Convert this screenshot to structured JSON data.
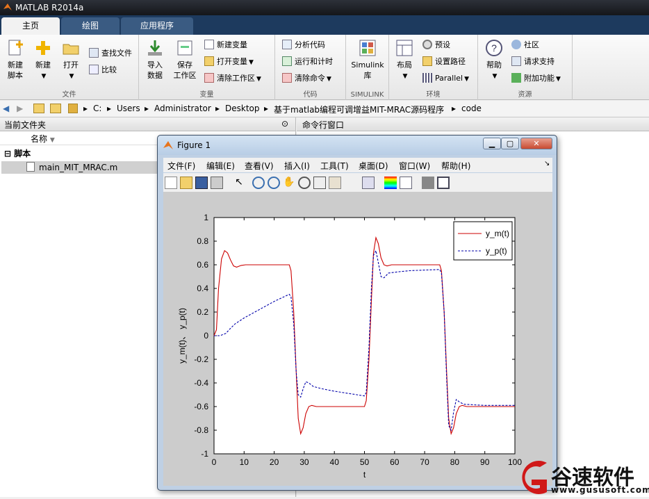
{
  "app": {
    "title": "MATLAB R2014a"
  },
  "tabs": [
    "主页",
    "绘图",
    "应用程序"
  ],
  "ribbon": {
    "file": {
      "new_script": [
        "新建",
        "脚本"
      ],
      "new": "新建",
      "open": "打开",
      "find_files": "查找文件",
      "compare": "比较",
      "label": "文件"
    },
    "variable": {
      "import": [
        "导入",
        "数据"
      ],
      "save": [
        "保存",
        "工作区"
      ],
      "new_var": "新建变量",
      "open_var": "打开变量",
      "clear_ws": "清除工作区",
      "label": "变量"
    },
    "code": {
      "analyze": "分析代码",
      "run_time": "运行和计时",
      "clear_cmd": "清除命令",
      "label": "代码"
    },
    "simulink": {
      "lib": [
        "Simulink",
        "库"
      ],
      "label": "SIMULINK"
    },
    "env": {
      "layout": "布局",
      "prefs": "预设",
      "set_path": "设置路径",
      "parallel": "Parallel",
      "label": "环境"
    },
    "resources": {
      "help": "帮助",
      "community": "社区",
      "support": "请求支持",
      "addons": "附加功能",
      "label": "资源"
    }
  },
  "address": [
    "C:",
    "Users",
    "Administrator",
    "Desktop",
    "基于matlab编程可调增益MIT-MRAC源码程序",
    "code"
  ],
  "current_folder": {
    "title": "当前文件夹",
    "col_name": "名称",
    "group": "脚本",
    "file": "main_MIT_MRAC.m"
  },
  "command_window": {
    "title": "命令行窗口"
  },
  "figure": {
    "title": "Figure 1",
    "menu": [
      "文件(F)",
      "编辑(E)",
      "查看(V)",
      "插入(I)",
      "工具(T)",
      "桌面(D)",
      "窗口(W)",
      "帮助(H)"
    ]
  },
  "watermark": {
    "name": "谷速软件",
    "url": "www.gususoft.com"
  },
  "chart_data": {
    "type": "line",
    "xlabel": "t",
    "ylabel": "y_m(t)、 y_p(t)",
    "xlim": [
      0,
      100
    ],
    "ylim": [
      -1,
      1
    ],
    "xticks": [
      0,
      10,
      20,
      30,
      40,
      50,
      60,
      70,
      80,
      90,
      100
    ],
    "yticks": [
      -1,
      -0.8,
      -0.6,
      -0.4,
      -0.2,
      0,
      0.2,
      0.4,
      0.6,
      0.8,
      1
    ],
    "legend_position": "top-right",
    "series": [
      {
        "name": "y_m(t)",
        "color": "#cc0000",
        "style": "solid",
        "x": [
          0,
          0.8,
          1.5,
          2.5,
          3.5,
          4.5,
          5.5,
          6.5,
          7.5,
          9,
          10.5,
          12,
          15,
          20,
          25,
          25.6,
          26.5,
          27.3,
          28,
          28.8,
          29.6,
          30.5,
          31.5,
          32.5,
          34,
          36,
          40,
          45,
          50,
          50.6,
          51.5,
          52.3,
          53,
          53.8,
          54.6,
          55.5,
          56.5,
          57.5,
          59,
          61,
          65,
          70,
          75,
          75.6,
          76.5,
          77.3,
          78,
          78.8,
          79.6,
          80.5,
          81.5,
          82.5,
          84,
          86,
          90,
          95,
          100
        ],
        "y": [
          0,
          0.05,
          0.4,
          0.65,
          0.72,
          0.7,
          0.64,
          0.59,
          0.58,
          0.595,
          0.6,
          0.6,
          0.6,
          0.6,
          0.6,
          0.55,
          0.2,
          -0.3,
          -0.7,
          -0.83,
          -0.78,
          -0.66,
          -0.6,
          -0.59,
          -0.6,
          -0.6,
          -0.6,
          -0.6,
          -0.6,
          -0.55,
          -0.2,
          0.3,
          0.7,
          0.83,
          0.78,
          0.66,
          0.6,
          0.59,
          0.6,
          0.6,
          0.6,
          0.6,
          0.6,
          0.55,
          0.2,
          -0.3,
          -0.7,
          -0.83,
          -0.78,
          -0.66,
          -0.6,
          -0.59,
          -0.6,
          -0.6,
          -0.6,
          -0.6,
          -0.6
        ]
      },
      {
        "name": "y_p(t)",
        "color": "#0000aa",
        "style": "dashed",
        "x": [
          0,
          2,
          3,
          4,
          5,
          7,
          10,
          15,
          20,
          25,
          25.6,
          26.5,
          27.3,
          28,
          28.8,
          29.6,
          30.5,
          31.5,
          33,
          36,
          40,
          45,
          50,
          50.6,
          51.5,
          52.3,
          53,
          53.8,
          54.6,
          55.5,
          56.5,
          58,
          61,
          65,
          70,
          75,
          75.6,
          76.5,
          77.3,
          78,
          78.8,
          79.6,
          80.5,
          81.5,
          83,
          86,
          90,
          95,
          100
        ],
        "y": [
          0,
          0,
          0.01,
          0.02,
          0.05,
          0.1,
          0.15,
          0.22,
          0.29,
          0.35,
          0.33,
          0.1,
          -0.3,
          -0.5,
          -0.52,
          -0.45,
          -0.39,
          -0.4,
          -0.43,
          -0.45,
          -0.47,
          -0.49,
          -0.51,
          -0.48,
          -0.1,
          0.4,
          0.68,
          0.72,
          0.62,
          0.5,
          0.49,
          0.53,
          0.54,
          0.55,
          0.555,
          0.56,
          0.53,
          0.2,
          -0.35,
          -0.76,
          -0.8,
          -0.65,
          -0.54,
          -0.56,
          -0.58,
          -0.585,
          -0.59,
          -0.59,
          -0.59
        ]
      }
    ]
  }
}
